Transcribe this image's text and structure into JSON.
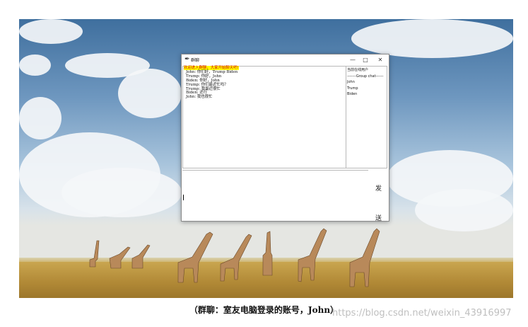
{
  "window": {
    "title": "群聊",
    "minimize": "—",
    "maximize": "□",
    "close": "✕"
  },
  "messages": [
    "欢迎进入群聊，大家开始聊天吧!",
    "John: 你们好，Trump Biden",
    "Trump: 你好，John",
    "Biden: 你好，John",
    "Trump: 你们最近忙吗？",
    "Trump: 我最近很忙",
    "Biden: 还行",
    "John: 我也很忙"
  ],
  "users": {
    "heading": "当前在线用户",
    "group_label": "-------Group chat------",
    "list": [
      "John",
      "Trump",
      "Biden"
    ]
  },
  "send_button": {
    "label_top": "发",
    "label_bottom": "送"
  },
  "caption": "（群聊：室友电脑登录的账号，John）",
  "watermark": "https://blog.csdn.net/weixin_43916997",
  "colors": {
    "welcome_highlight": "#ffff00",
    "welcome_text": "#d00000"
  }
}
